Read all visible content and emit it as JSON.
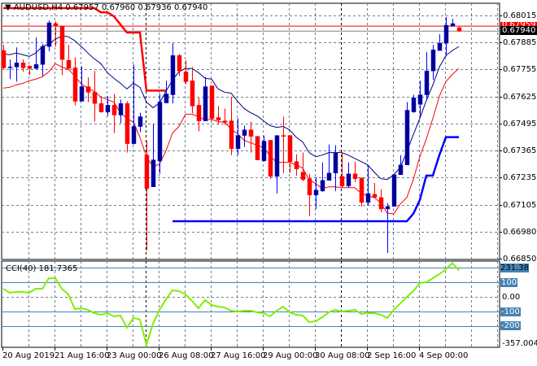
{
  "header": {
    "symbol_timeframe": "AUDUSD,H4",
    "ohlc_text": "0.67957 0.67960 0.67936 0.67940",
    "dropdown_icon": "triangle-down-icon"
  },
  "colors": {
    "bull_body": "#00008b",
    "bull_wick": "#0000ff",
    "bear": "#ff0000",
    "ma_fast": "#000080",
    "ma_slow": "#ff0000",
    "channel_low": "#0000ff",
    "channel_high": "#ff0000",
    "cci": "#80ee00",
    "cci_levels": "#4682b4",
    "grid": "#708090",
    "ask_line": "#ff0000",
    "bid_line": "#808080"
  },
  "chart_data": [
    {
      "type": "candlestick",
      "title": "AUDUSD,H4",
      "ylim": [
        0.6685,
        0.68015
      ],
      "y_ticks": [
        "0.68015",
        "0.67885",
        "0.67755",
        "0.67625",
        "0.67495",
        "0.67365",
        "0.67235",
        "0.67105",
        "0.66980",
        "0.66850"
      ],
      "x_ticks": [
        "20 Aug 2019",
        "21 Aug 16:00",
        "23 Aug 00:00",
        "26 Aug 08:00",
        "27 Aug 16:00",
        "29 Aug 00:00",
        "30 Aug 08:00",
        "2 Sep 16:00",
        "4 Sep 00:00"
      ],
      "ask_price": 0.67964,
      "ask_label": "0.67959",
      "bid_price": 0.6794,
      "bid_label": "0.67940",
      "candles": [
        [
          0.67847,
          0.67874,
          0.67757,
          0.67764
        ],
        [
          0.67764,
          0.67804,
          0.6771,
          0.67768
        ],
        [
          0.67768,
          0.67862,
          0.67698,
          0.67788
        ],
        [
          0.67788,
          0.67804,
          0.67745,
          0.67764
        ],
        [
          0.67772,
          0.67776,
          0.67729,
          0.67761
        ],
        [
          0.67761,
          0.67909,
          0.67757,
          0.6778
        ],
        [
          0.6778,
          0.67878,
          0.67725,
          0.67866
        ],
        [
          0.67866,
          0.67991,
          0.67843,
          0.6798
        ],
        [
          0.67976,
          0.67987,
          0.67866,
          0.67964
        ],
        [
          0.67964,
          0.67964,
          0.67729,
          0.67804
        ],
        [
          0.678,
          0.67874,
          0.67761,
          0.67761
        ],
        [
          0.67764,
          0.67815,
          0.67585,
          0.67604
        ],
        [
          0.67604,
          0.67772,
          0.67604,
          0.67674
        ],
        [
          0.67674,
          0.67718,
          0.676,
          0.67647
        ],
        [
          0.67647,
          0.67749,
          0.67506,
          0.67593
        ],
        [
          0.67593,
          0.67628,
          0.67549,
          0.67553
        ],
        [
          0.67553,
          0.67628,
          0.67534,
          0.67585
        ],
        [
          0.67585,
          0.67639,
          0.67452,
          0.67538
        ],
        [
          0.67538,
          0.67612,
          0.67499,
          0.67593
        ],
        [
          0.67593,
          0.67604,
          0.67358,
          0.67401
        ],
        [
          0.67401,
          0.6778,
          0.67397,
          0.67483
        ],
        [
          0.67483,
          0.67549,
          0.67456,
          0.6753
        ],
        [
          0.67346,
          0.67413,
          0.66889,
          0.67186
        ],
        [
          0.67194,
          0.67495,
          0.67194,
          0.67323
        ],
        [
          0.67319,
          0.67639,
          0.67256,
          0.676
        ],
        [
          0.67596,
          0.67702,
          0.67596,
          0.67639
        ],
        [
          0.67635,
          0.67882,
          0.67593,
          0.67823
        ],
        [
          0.67823,
          0.67831,
          0.67725,
          0.67749
        ],
        [
          0.67745,
          0.678,
          0.67686,
          0.67698
        ],
        [
          0.67702,
          0.67768,
          0.67546,
          0.67581
        ],
        [
          0.67585,
          0.6762,
          0.6746,
          0.6751
        ],
        [
          0.6751,
          0.67721,
          0.6751,
          0.67674
        ],
        [
          0.67678,
          0.67678,
          0.6751,
          0.67522
        ],
        [
          0.67526,
          0.67581,
          0.67491,
          0.67514
        ],
        [
          0.6751,
          0.67569,
          0.67491,
          0.67503
        ],
        [
          0.6751,
          0.67624,
          0.67346,
          0.67377
        ],
        [
          0.67377,
          0.67522,
          0.67346,
          0.6744
        ],
        [
          0.6744,
          0.67487,
          0.67385,
          0.67467
        ],
        [
          0.67467,
          0.67506,
          0.67358,
          0.67436
        ],
        [
          0.67436,
          0.67436,
          0.67323,
          0.67323
        ],
        [
          0.67319,
          0.6744,
          0.67315,
          0.67413
        ],
        [
          0.67417,
          0.67417,
          0.67233,
          0.67244
        ],
        [
          0.67244,
          0.6744,
          0.67162,
          0.6744
        ],
        [
          0.6744,
          0.6753,
          0.6726,
          0.67436
        ],
        [
          0.6744,
          0.6744,
          0.6726,
          0.67315
        ],
        [
          0.67315,
          0.6735,
          0.67248,
          0.6728
        ],
        [
          0.67264,
          0.67358,
          0.67221,
          0.67229
        ],
        [
          0.67233,
          0.67256,
          0.67053,
          0.67155
        ],
        [
          0.67155,
          0.67241,
          0.67088,
          0.67178
        ],
        [
          0.67174,
          0.67311,
          0.6717,
          0.67225
        ],
        [
          0.67225,
          0.67397,
          0.67225,
          0.6726
        ],
        [
          0.6726,
          0.67393,
          0.67174,
          0.67358
        ],
        [
          0.67244,
          0.67362,
          0.6719,
          0.67198
        ],
        [
          0.67198,
          0.67311,
          0.6719,
          0.67256
        ],
        [
          0.67256,
          0.67315,
          0.67217,
          0.67233
        ],
        [
          0.67237,
          0.67237,
          0.671,
          0.67119
        ],
        [
          0.67119,
          0.67299,
          0.67104,
          0.67162
        ],
        [
          0.67158,
          0.67213,
          0.67139,
          0.67143
        ],
        [
          0.67143,
          0.67182,
          0.67073,
          0.67088
        ],
        [
          0.67088,
          0.67116,
          0.66877,
          0.671
        ],
        [
          0.671,
          0.67252,
          0.671,
          0.67252
        ],
        [
          0.67252,
          0.67346,
          0.67252,
          0.67299
        ],
        [
          0.67299,
          0.676,
          0.67299,
          0.67561
        ],
        [
          0.67553,
          0.67635,
          0.67549,
          0.6762
        ],
        [
          0.67589,
          0.67702,
          0.67534,
          0.67635
        ],
        [
          0.67635,
          0.67839,
          0.67608,
          0.67749
        ],
        [
          0.67749,
          0.67874,
          0.67706,
          0.6785
        ],
        [
          0.67847,
          0.67925,
          0.67847,
          0.67882
        ],
        [
          0.67882,
          0.68007,
          0.67819,
          0.67968
        ],
        [
          0.67964,
          0.67999,
          0.67964,
          0.67976
        ],
        [
          0.67957,
          0.6796,
          0.67936,
          0.6794
        ]
      ],
      "ma_fast": [
        0.67831,
        0.67827,
        0.67835,
        0.67827,
        0.67819,
        0.67835,
        0.67866,
        0.67878,
        0.67901,
        0.67917,
        0.67913,
        0.67894,
        0.67866,
        0.67835,
        0.67807,
        0.67784,
        0.67741,
        0.67714,
        0.6769,
        0.67663,
        0.6769,
        0.67671,
        0.676,
        0.67573,
        0.67596,
        0.67651,
        0.67706,
        0.67745,
        0.67761,
        0.67761,
        0.67741,
        0.67714,
        0.6771,
        0.67663,
        0.67647,
        0.67643,
        0.67604,
        0.67569,
        0.67549,
        0.67534,
        0.6751,
        0.67487,
        0.67479,
        0.67483,
        0.67467,
        0.67432,
        0.67409,
        0.67358,
        0.67338,
        0.67346,
        0.67358,
        0.67358,
        0.67358,
        0.67346,
        0.6733,
        0.67315,
        0.67299,
        0.67264,
        0.67233,
        0.67229,
        0.67252,
        0.67287,
        0.67362,
        0.67444,
        0.67522,
        0.67608,
        0.67682,
        0.67768,
        0.67823,
        0.67847,
        0.67866
      ],
      "ma_slow": [
        0.67667,
        0.67671,
        0.67682,
        0.6769,
        0.67702,
        0.6771,
        0.67721,
        0.67745,
        0.67784,
        0.67768,
        0.67757,
        0.67725,
        0.67686,
        0.67667,
        0.67651,
        0.67624,
        0.67612,
        0.676,
        0.67549,
        0.67522,
        0.67503,
        0.67432,
        0.67338,
        0.67291,
        0.67303,
        0.67366,
        0.67452,
        0.67483,
        0.67542,
        0.67542,
        0.6753,
        0.67514,
        0.67518,
        0.67506,
        0.67503,
        0.67471,
        0.67448,
        0.67417,
        0.67405,
        0.67393,
        0.67381,
        0.67342,
        0.67311,
        0.67311,
        0.67311,
        0.67299,
        0.67284,
        0.67229,
        0.67209,
        0.67186,
        0.67194,
        0.67194,
        0.6719,
        0.6719,
        0.6719,
        0.67162,
        0.67151,
        0.67143,
        0.67116,
        0.67068,
        0.67065,
        0.67112,
        0.67143,
        0.67229,
        0.67338,
        0.67424,
        0.67522,
        0.67628,
        0.67698,
        0.67733,
        0.67761
      ],
      "channel_high": {
        "start_index": 0,
        "values": [
          0.6805,
          0.6805,
          0.6805,
          0.6805,
          0.6805,
          0.6805,
          0.6805,
          0.6805,
          0.6805,
          0.6805,
          0.6805,
          0.6805,
          0.6805,
          0.6805,
          0.6805,
          0.6803,
          0.6803,
          0.68011,
          0.67972,
          0.67933,
          0.67933,
          0.67933,
          0.67655,
          0.67655,
          0.67655,
          0.67655
        ]
      },
      "channel_low": {
        "start_index": 26,
        "values": [
          0.67029,
          0.67029,
          0.67029,
          0.67029,
          0.67029,
          0.67029,
          0.67029,
          0.67029,
          0.67029,
          0.67029,
          0.67029,
          0.67029,
          0.67029,
          0.67029,
          0.67029,
          0.67029,
          0.67029,
          0.67029,
          0.67029,
          0.67029,
          0.67029,
          0.67029,
          0.67029,
          0.67029,
          0.67029,
          0.67029,
          0.67029,
          0.67029,
          0.67029,
          0.67029,
          0.67029,
          0.67029,
          0.67029,
          0.67029,
          0.67029,
          0.67029,
          0.67029,
          0.67065,
          0.67131,
          0.67248,
          0.67248,
          0.67346,
          0.67432,
          0.67432,
          0.67432
        ]
      }
    },
    {
      "type": "line",
      "title": "CCI(40)",
      "current_value": "181.7365",
      "ylim": [
        -357.0045,
        231.38
      ],
      "y_tick_labels": {
        "max": "231.38",
        "l100": "100",
        "l0": "0.00",
        "lm100": "-100",
        "lm200": "-200",
        "min": "-357.0045"
      },
      "levels": [
        200,
        100,
        -100,
        -200
      ],
      "values": [
        56,
        28,
        34,
        34,
        28,
        56,
        56,
        128,
        128,
        56,
        17,
        -84,
        -78,
        -89,
        -112,
        -123,
        -112,
        -134,
        -128,
        -212,
        -145,
        -156,
        -330,
        -184,
        -89,
        -17,
        45,
        39,
        17,
        -28,
        -78,
        -22,
        -56,
        -67,
        -73,
        -95,
        -101,
        -95,
        -95,
        -106,
        -112,
        -134,
        -95,
        -67,
        -106,
        -123,
        -128,
        -173,
        -168,
        -140,
        -106,
        -89,
        -101,
        -95,
        -89,
        -117,
        -112,
        -112,
        -123,
        -145,
        -89,
        -45,
        0,
        39,
        95,
        101,
        128,
        156,
        190,
        231.38,
        181.7365
      ]
    }
  ]
}
